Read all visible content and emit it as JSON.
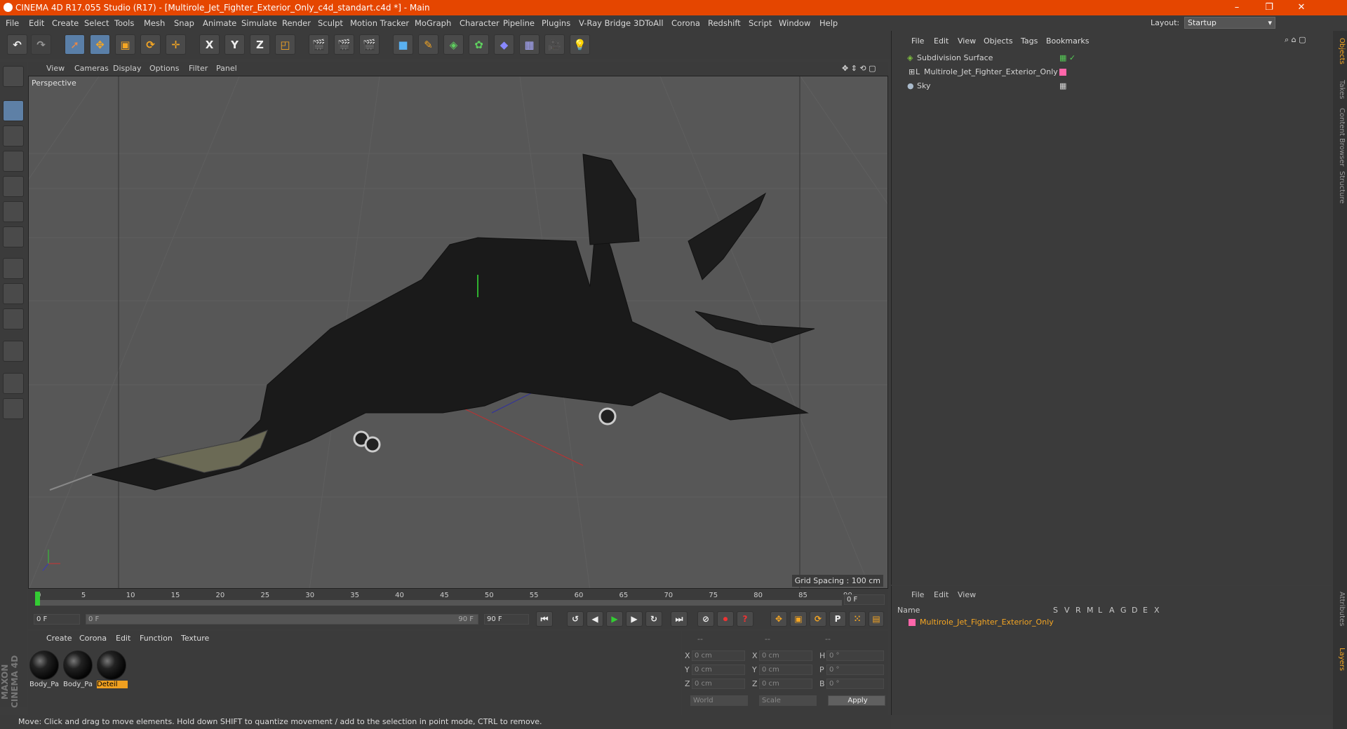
{
  "window": {
    "title": "CINEMA 4D R17.055 Studio (R17) - [Multirole_Jet_Fighter_Exterior_Only_c4d_standart.c4d *] - Main"
  },
  "menu": [
    "File",
    "Edit",
    "Create",
    "Select",
    "Tools",
    "Mesh",
    "Snap",
    "Animate",
    "Simulate",
    "Render",
    "Sculpt",
    "Motion Tracker",
    "MoGraph",
    "Character",
    "Pipeline",
    "Plugins",
    "V-Ray Bridge",
    "3DToAll",
    "Corona",
    "Redshift",
    "Script",
    "Window",
    "Help"
  ],
  "layout": {
    "label": "Layout:",
    "value": "Startup"
  },
  "toolbar": {
    "x_axis": "X",
    "y_axis": "Y",
    "z_axis": "Z"
  },
  "viewport": {
    "menu": [
      "View",
      "Cameras",
      "Display",
      "Options",
      "Filter",
      "Panel"
    ],
    "camera_label": "Perspective",
    "grid_spacing": "Grid Spacing : 100 cm"
  },
  "timeline": {
    "ticks": [
      "0",
      "5",
      "10",
      "15",
      "20",
      "25",
      "30",
      "35",
      "40",
      "45",
      "50",
      "55",
      "60",
      "65",
      "70",
      "75",
      "80",
      "85",
      "90"
    ],
    "current_frame": "0 F",
    "start_field": "0 F",
    "range_start": "0 F",
    "range_end": "90 F",
    "end_field": "90 F"
  },
  "material_manager": {
    "menu": [
      "Create",
      "Corona",
      "Edit",
      "Function",
      "Texture"
    ],
    "materials": [
      {
        "name": "Body_Pa",
        "selected": false
      },
      {
        "name": "Body_Pa",
        "selected": false
      },
      {
        "name": "Deteil",
        "selected": true
      }
    ]
  },
  "coordinates": {
    "headers": [
      "--",
      "--",
      "--"
    ],
    "rows": [
      {
        "a": "X",
        "v1": "0 cm",
        "b": "X",
        "v2": "0 cm",
        "c": "H",
        "v3": "0 °"
      },
      {
        "a": "Y",
        "v1": "0 cm",
        "b": "Y",
        "v2": "0 cm",
        "c": "P",
        "v3": "0 °"
      },
      {
        "a": "Z",
        "v1": "0 cm",
        "b": "Z",
        "v2": "0 cm",
        "c": "B",
        "v3": "0 °"
      }
    ],
    "world": "World",
    "scale": "Scale",
    "apply": "Apply"
  },
  "object_manager": {
    "menu": [
      "File",
      "Edit",
      "View",
      "Objects",
      "Tags",
      "Bookmarks"
    ],
    "objects": [
      {
        "name": "Subdivision Surface",
        "color": "#7fbf3f"
      },
      {
        "name": "Multirole_Jet_Fighter_Exterior_Only",
        "color": "#ff66aa"
      },
      {
        "name": "Sky",
        "color": "#aabbcc"
      }
    ]
  },
  "layer_manager": {
    "menu": [
      "File",
      "Edit",
      "View"
    ],
    "name_header": "Name",
    "flag_headers": [
      "S",
      "V",
      "R",
      "M",
      "L",
      "A",
      "G",
      "D",
      "E",
      "X"
    ],
    "layer": {
      "name": "Multirole_Jet_Fighter_Exterior_Only",
      "color": "#ff66aa"
    }
  },
  "right_tabs": [
    "Objects",
    "Takes",
    "Content Browser",
    "Structure",
    "Attributes",
    "Layers"
  ],
  "status": "Move: Click and drag to move elements. Hold down SHIFT to quantize movement / add to the selection in point mode, CTRL to remove.",
  "brand": "MAXON CINEMA 4D"
}
